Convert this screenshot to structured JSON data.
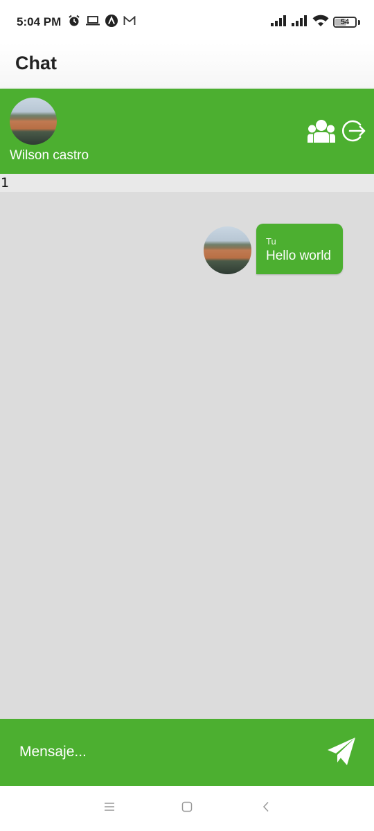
{
  "status_bar": {
    "time": "5:04 PM",
    "left_icons": [
      "alarm-icon",
      "laptop-icon",
      "a-circle-icon",
      "gmail-icon"
    ],
    "right_icons": [
      "signal-icon",
      "signal-icon",
      "wifi-icon",
      "battery-icon"
    ],
    "battery_level": "54"
  },
  "app_bar": {
    "title": "Chat"
  },
  "chat_header": {
    "user_name": "Wilson castro",
    "icons": [
      "group-icon",
      "logout-icon"
    ]
  },
  "counter": "1",
  "messages": [
    {
      "author": "Tu",
      "text": "Hello world"
    }
  ],
  "input": {
    "placeholder": "Mensaje...",
    "send_icon": "send-icon"
  },
  "nav_bar": {
    "icons": [
      "menu-icon",
      "home-icon",
      "back-icon"
    ]
  },
  "colors": {
    "primary_green": "#4caf30",
    "chat_background": "#dcdcdc",
    "counter_background": "#e9e9e9"
  }
}
